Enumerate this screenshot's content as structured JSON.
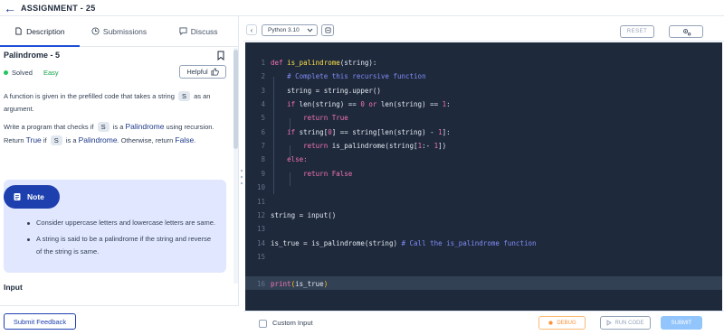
{
  "header": {
    "title": "ASSIGNMENT - 25"
  },
  "tabs": [
    {
      "label": "Description"
    },
    {
      "label": "Submissions"
    },
    {
      "label": "Discuss"
    }
  ],
  "problem": {
    "title": "Palindrome - 5",
    "status": "Solved",
    "difficulty": "Easy",
    "helpful_label": "Helpful",
    "para1_a": "A function is given in the prefilled code that takes a string",
    "para1_pill": "S",
    "para1_b": "as an argument.",
    "para2_a": "Write a program that checks if",
    "para2_pill1": "S",
    "para2_b": "is a",
    "para2_hl1": "Palindrome",
    "para2_c": "using recursion.",
    "para2_d": "Return",
    "para2_hl2": "True",
    "para2_e": "if",
    "para2_pill2": "S",
    "para2_f": "is a",
    "para2_hl3": "Palindrome",
    "para2_g": ". Otherwise, return",
    "para2_hl4": "False",
    "para2_h": "."
  },
  "note": {
    "label": "Note",
    "items": [
      "Consider uppercase letters and lowercase letters are same.",
      "A string is said to be a palindrome if the string and reverse of the string is same."
    ]
  },
  "input_section": {
    "label": "Input"
  },
  "feedback": {
    "label": "Submit Feedback"
  },
  "editor": {
    "language": "Python 3.10",
    "reset_label": "RESET",
    "line_numbers": [
      "1",
      "2",
      "3",
      "4",
      "5",
      "6",
      "7",
      "8",
      "9",
      "10",
      "11",
      "12",
      "13",
      "14",
      "15",
      "16"
    ],
    "code": {
      "l1_kw": "def",
      "l1_fn": "is_palindrome",
      "l1_rest": "(string):",
      "l2": "# Complete this recursive function",
      "l3": "string = string.upper()",
      "l4_kw": "if",
      "l4_a": "len(string) ==",
      "l4_n": "0",
      "l4_or": "or",
      "l4_b": "len(string) ==",
      "l4_n2": "1",
      "l4_c": ":",
      "l5_kw": "return",
      "l5_v": "True",
      "l6_kw": "if",
      "l6_a": "string[",
      "l6_n": "0",
      "l6_b": "] == string[len(string) -",
      "l6_n2": "1",
      "l6_c": "]:",
      "l7_kw": "return",
      "l7_a": "is_palindrome(string[",
      "l7_n": "1",
      "l7_b": ":-",
      "l7_n2": "1",
      "l7_c": "])",
      "l8_kw": "else:",
      "l9_kw": "return",
      "l9_v": "False",
      "l12_a": "string = input()",
      "l14_a": "is_true = is_palindrome(string)",
      "l14_c": "# Call the is_palindrome function",
      "l16_fn": "print",
      "l16_p1": "(",
      "l16_a": "is_true",
      "l16_p2": ")"
    }
  },
  "footer": {
    "custom_input_label": "Custom Input",
    "debug_label": "DEBUG",
    "run_label": "RUN CODE",
    "submit_label": "SUBMIT"
  },
  "colors": {
    "editor_bg": "#1e293b",
    "accent": "#1e40af",
    "keyword": "#f472b6",
    "function": "#fde047",
    "comment": "#818cf8",
    "solved_dot": "#22c55e"
  }
}
